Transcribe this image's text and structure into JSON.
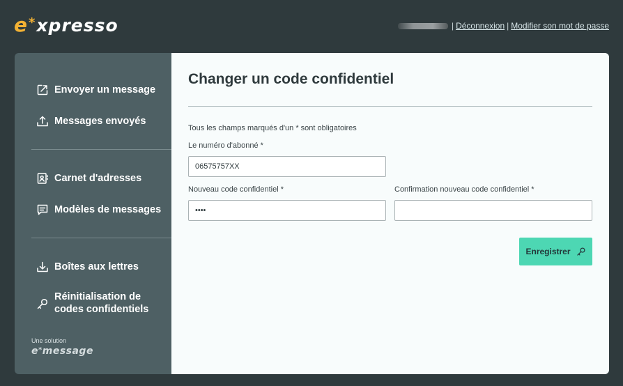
{
  "brand": {
    "e": "e",
    "star": "*",
    "rest": "xpresso"
  },
  "topnav": {
    "user": "utilisateur",
    "logout": "Déconnexion",
    "separator": "|",
    "change_password": "Modifier son mot de passe"
  },
  "sidebar": {
    "items": [
      {
        "label": "Envoyer un message",
        "icon": "send-icon"
      },
      {
        "label": "Messages envoyés",
        "icon": "upload-icon"
      },
      {
        "label": "Carnet d'adresses",
        "icon": "address-book-icon"
      },
      {
        "label": "Modèles de messages",
        "icon": "message-template-icon"
      },
      {
        "label": "Boîtes aux lettres",
        "icon": "download-icon"
      },
      {
        "label": "Réinitialisation de codes confidentiels",
        "icon": "key-icon"
      }
    ],
    "solution_label": "Une solution",
    "solution_brand": {
      "e": "e",
      "star": "*",
      "rest": "message"
    }
  },
  "main": {
    "title": "Changer un code confidentiel",
    "required_note": "Tous les champs marqués d'un * sont obligatoires",
    "subscriber_label": "Le numéro d'abonné *",
    "subscriber_value": "06575757XX",
    "new_code_label": "Nouveau code confidentiel *",
    "new_code_value": "1234",
    "confirm_code_label": "Confirmation nouveau code confidentiel *",
    "confirm_code_value": "",
    "save_label": "Enregistrer",
    "save_icon": "key-icon"
  },
  "colors": {
    "background": "#2f3a3d",
    "sidebar": "#4e6064",
    "accent": "#4dd7b3",
    "brand": "#f2b134"
  }
}
